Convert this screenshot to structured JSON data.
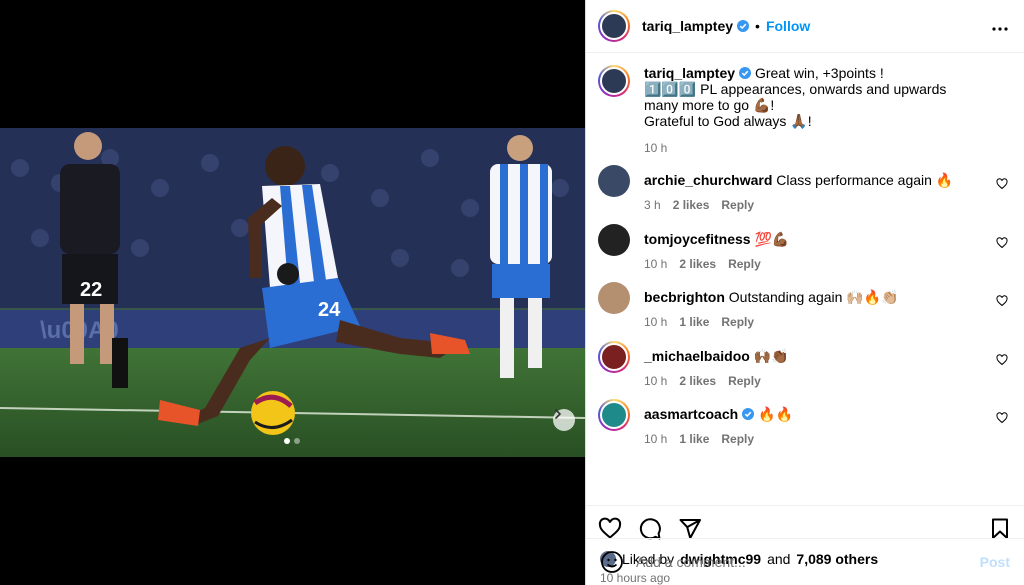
{
  "post": {
    "author": "tariq_lamptey",
    "follow_label": "Follow",
    "caption_lines": [
      "Great win, +3points !",
      "1️⃣0️⃣0️⃣ PL appearances, onwards and upwards many more to go 💪🏾!",
      "Grateful to God always 🙏🏾!"
    ],
    "caption_time": "10 h"
  },
  "comments": [
    {
      "user": "archie_churchward",
      "text": "Class performance again 🔥",
      "time": "3 h",
      "likes": "2 likes",
      "reply": "Reply",
      "avatar_color": "#3a4a66"
    },
    {
      "user": "tomjoycefitness",
      "text": "💯💪🏾",
      "time": "10 h",
      "likes": "2 likes",
      "reply": "Reply",
      "avatar_color": "#222222"
    },
    {
      "user": "becbrighton",
      "text": "Outstanding again 🙌🏼🔥👏🏼",
      "time": "10 h",
      "likes": "1 like",
      "reply": "Reply",
      "avatar_color": "#b49070"
    },
    {
      "user": "_michaelbaidoo",
      "text": "🙌🏾👏🏾",
      "time": "10 h",
      "likes": "2 likes",
      "reply": "Reply",
      "avatar_color": "#7a2020"
    },
    {
      "user": "aasmartcoach",
      "text": "🔥🔥",
      "time": "10 h",
      "likes": "1 like",
      "reply": "Reply",
      "avatar_color": "#1f8a8a"
    }
  ],
  "likes": {
    "prefix": "Liked by",
    "user": "dwightmc99",
    "and": "and",
    "others": "7,089 others"
  },
  "posted_time": "10 hours ago",
  "composer": {
    "placeholder": "Add a comment...",
    "post_label": "Post"
  },
  "colors": {
    "accent": "#0095f6",
    "verified": "#3897f0",
    "muted": "#737373"
  }
}
